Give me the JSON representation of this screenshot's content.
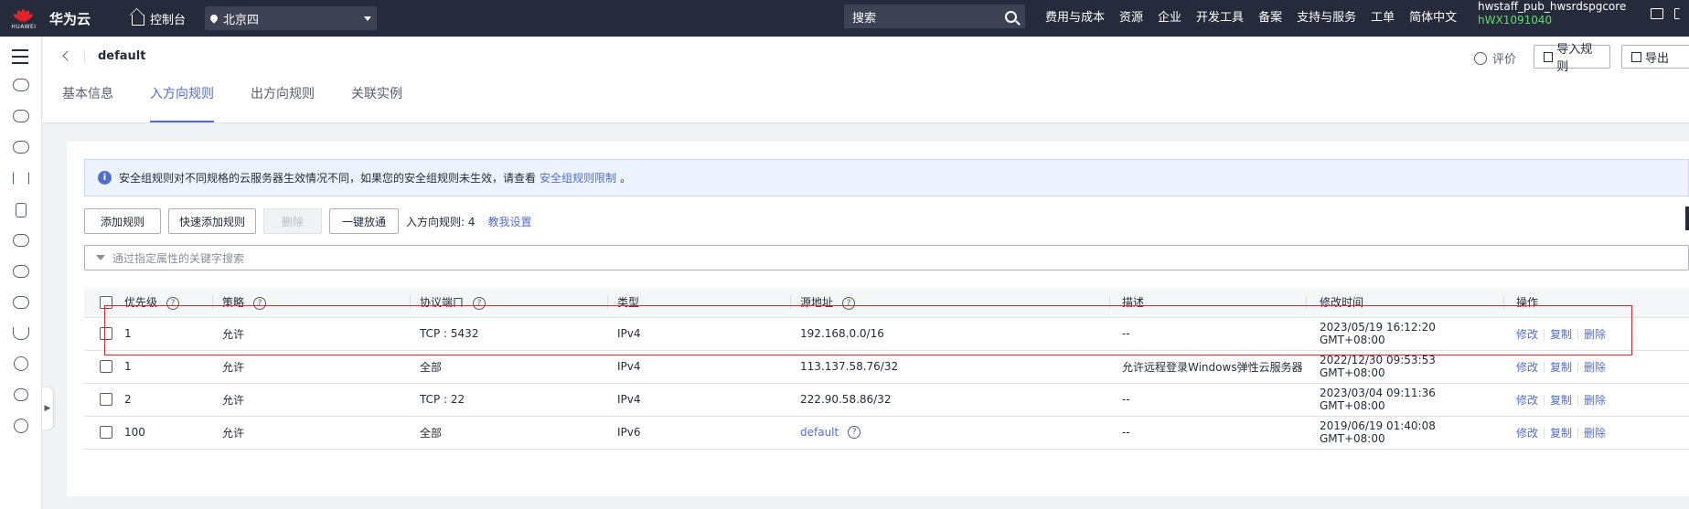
{
  "topbar": {
    "logo_text": "HUAWEI",
    "brand": "华为云",
    "console": "控制台",
    "region": "北京四",
    "search_placeholder": "搜索",
    "nav": [
      "费用与成本",
      "资源",
      "企业",
      "开发工具",
      "备案",
      "支持与服务",
      "工单",
      "简体中文"
    ],
    "user_name": "hwstaff_pub_hwsrdspgcore",
    "user_id": "hWX1091040"
  },
  "header": {
    "title": "default",
    "rate": "评价",
    "import_btn": "导入规则",
    "export_btn": "导出",
    "tabs": [
      "基本信息",
      "入方向规则",
      "出方向规则",
      "关联实例"
    ],
    "active_tab": 1
  },
  "info": {
    "text": "安全组规则对不同规格的云服务器生效情况不同，如果您的安全组规则未生效，请查看",
    "link": "安全组规则限制",
    "suffix": "。"
  },
  "toolbar": {
    "add": "添加规则",
    "quick_add": "快速添加规则",
    "delete": "删除",
    "one_click": "一键放通",
    "count_text": "入方向规则: 4",
    "help_link": "教我设置"
  },
  "filter_placeholder": "通过指定属性的关键字搜索",
  "table": {
    "headers": [
      "优先级",
      "策略",
      "协议端口",
      "类型",
      "源地址",
      "描述",
      "修改时间",
      "操作"
    ],
    "rows": [
      {
        "priority": "1",
        "policy": "允许",
        "port": "TCP : 5432",
        "type": "IPv4",
        "source": "192.168.0.0/16",
        "desc": "--",
        "time": "2023/05/19 16:12:20 GMT+08:00"
      },
      {
        "priority": "1",
        "policy": "允许",
        "port": "全部",
        "type": "IPv4",
        "source": "113.137.58.76/32",
        "desc": "允许远程登录Windows弹性云服务器",
        "time": "2022/12/30 09:53:53 GMT+08:00"
      },
      {
        "priority": "2",
        "policy": "允许",
        "port": "TCP : 22",
        "type": "IPv4",
        "source": "222.90.58.86/32",
        "desc": "--",
        "time": "2023/03/04 09:11:36 GMT+08:00"
      },
      {
        "priority": "100",
        "policy": "允许",
        "port": "全部",
        "type": "IPv6",
        "source": "default",
        "desc": "--",
        "time": "2019/06/19 01:40:08 GMT+08:00"
      }
    ],
    "ops": [
      "修改",
      "复制",
      "删除"
    ]
  }
}
